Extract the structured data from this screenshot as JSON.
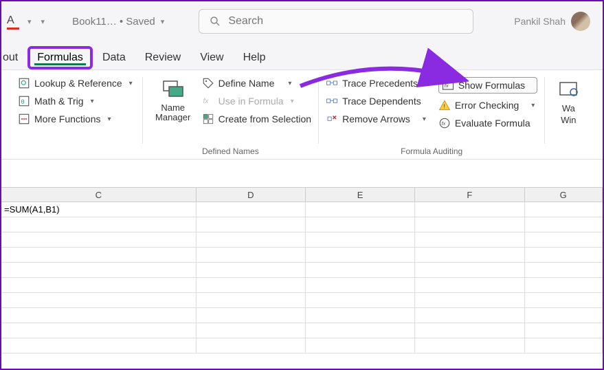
{
  "titlebar": {
    "doc_name": "Book11…",
    "saved_label": "• Saved",
    "search_placeholder": "Search",
    "user_name": "Pankil Shah"
  },
  "tabs": {
    "about": "out",
    "formulas": "Formulas",
    "data": "Data",
    "review": "Review",
    "view": "View",
    "help": "Help"
  },
  "ribbon": {
    "lookup": "Lookup & Reference",
    "math": "Math & Trig",
    "more": "More Functions",
    "name_manager": "Name Manager",
    "define_name": "Define Name",
    "use_in_formula": "Use in Formula",
    "create_selection": "Create from Selection",
    "defined_names_label": "Defined Names",
    "trace_precedents": "Trace Precedents",
    "trace_dependents": "Trace Dependents",
    "remove_arrows": "Remove Arrows",
    "show_formulas": "Show Formulas",
    "error_checking": "Error Checking",
    "evaluate_formula": "Evaluate Formula",
    "formula_auditing_label": "Formula Auditing",
    "watch": "Wa",
    "window": "Win"
  },
  "columns": {
    "c": "C",
    "d": "D",
    "e": "E",
    "f": "F",
    "g": "G"
  },
  "cells": {
    "c1": "=SUM(A1,B1)"
  }
}
